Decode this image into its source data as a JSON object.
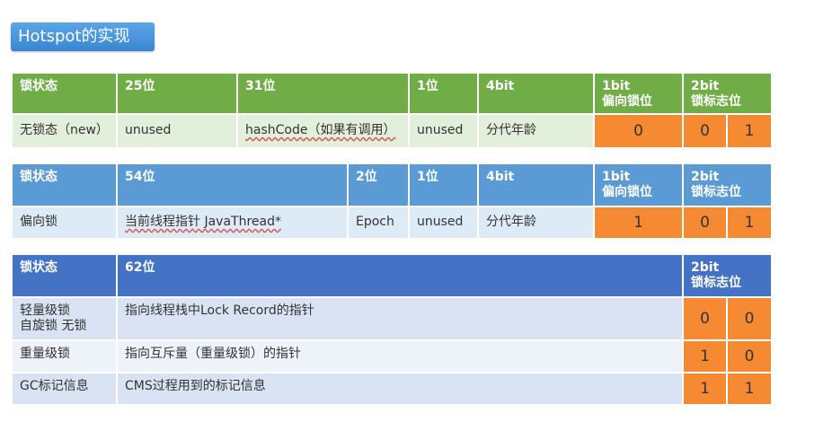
{
  "title": "Hotspot的实现",
  "table1": {
    "headers": [
      "锁状态",
      "25位",
      "31位",
      "1位",
      "4bit",
      "1bit\n偏向锁位",
      "2bit\n锁标志位"
    ],
    "row": [
      "无锁态（new）",
      "unused",
      "hashCode（如果有调用）",
      "unused",
      "分代年龄",
      "0",
      "0",
      "1"
    ]
  },
  "table2": {
    "headers": [
      "锁状态",
      "54位",
      "2位",
      "1位",
      "4bit",
      "1bit\n偏向锁位",
      "2bit\n锁标志位"
    ],
    "row": [
      "偏向锁",
      "当前线程指针 JavaThread*",
      "Epoch",
      "unused",
      "分代年龄",
      "1",
      "0",
      "1"
    ]
  },
  "table3": {
    "headers": [
      "锁状态",
      "62位",
      "2bit\n锁标志位"
    ],
    "rows": [
      [
        "轻量级锁\n自旋锁 无锁",
        "指向线程栈中Lock Record的指针",
        "0",
        "0"
      ],
      [
        "重量级锁",
        "指向互斥量（重量级锁）的指针",
        "1",
        "0"
      ],
      [
        "GC标记信息",
        "CMS过程用到的标记信息",
        "1",
        "1"
      ]
    ]
  },
  "colors": {
    "green_header": "#70ad47",
    "green_row": "#e2efda",
    "blue_header": "#5b9bd5",
    "blue_row": "#ddebf7",
    "dark_blue_header": "#4472c4",
    "orange": "#f58a33"
  }
}
